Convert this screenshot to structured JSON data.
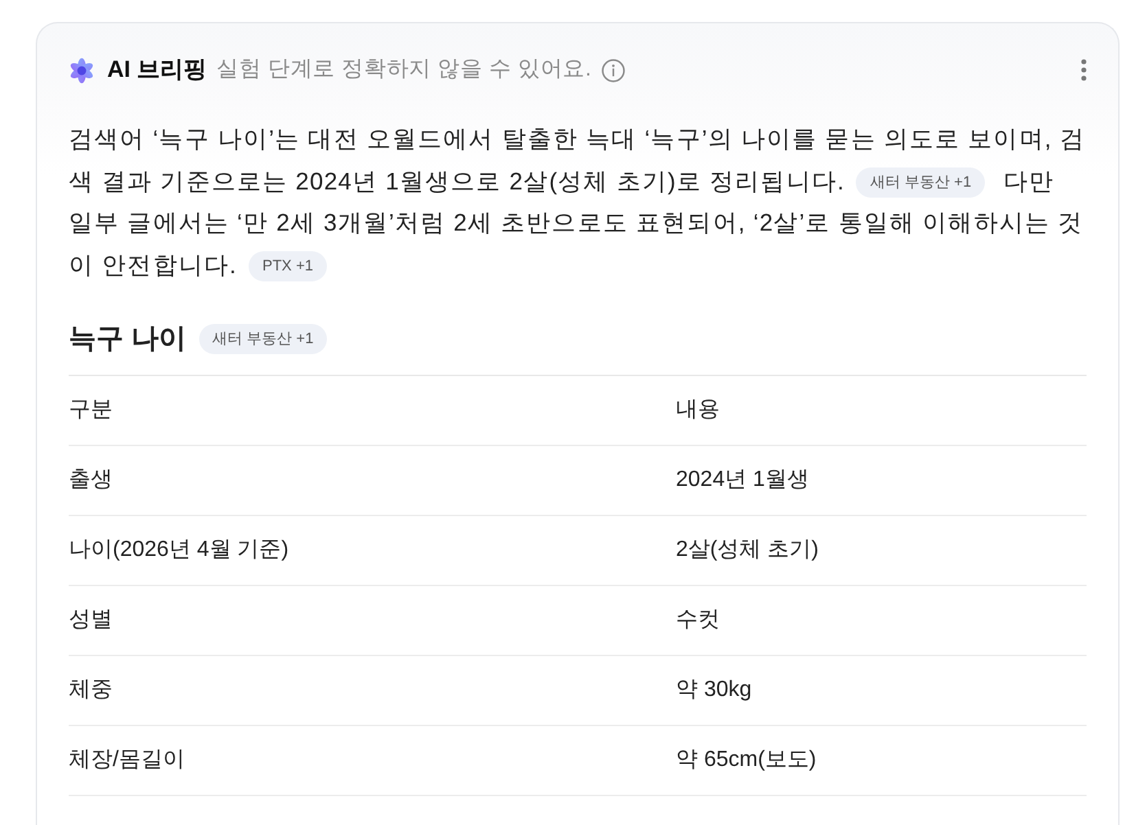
{
  "header": {
    "title": "AI 브리핑",
    "subtitle": "실험 단계로 정확하지 않을 수 있어요."
  },
  "summary": [
    {
      "text": "검색어 ‘늑구 나이’는 대전 오월드에서 탈출한 늑대 ‘늑구’의 나이를 묻는 의도로 보이며, 검색 결과 기준으로는 2024년 1월생으로 2살(성체 초기)로 정리됩니다.",
      "source": "새터 부동산 +1"
    },
    {
      "text": "다만 일부 글에서는 ‘만 2세 3개월’처럼 2세 초반으로도 표현되어, ‘2살’로 통일해 이해하시는 것이 안전합니다.",
      "source": "PTX +1"
    }
  ],
  "section": {
    "title": "늑구 나이",
    "source": "새터 부동산 +1"
  },
  "table": {
    "columns": [
      "구분",
      "내용"
    ],
    "rows": [
      [
        "출생",
        "2024년 1월생"
      ],
      [
        "나이(2026년 4월 기준)",
        "2살(성체 초기)"
      ],
      [
        "성별",
        "수컷"
      ],
      [
        "체중",
        "약 30kg"
      ],
      [
        "체장/몸길이",
        "약 65cm(보도)"
      ]
    ]
  }
}
